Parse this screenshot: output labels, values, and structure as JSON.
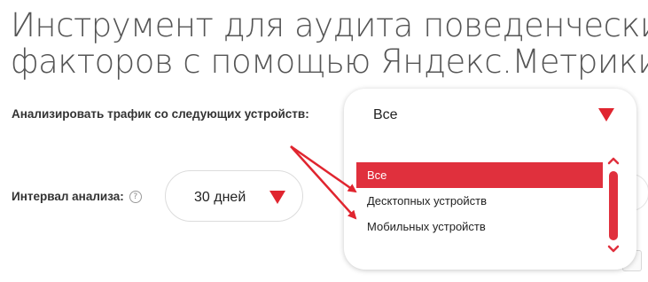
{
  "page": {
    "title_line1": "Инструмент для аудита поведенческих",
    "title_line2": "факторов с помощью Яндекс.Метрики"
  },
  "devices": {
    "label": "Анализировать трафик со следующих устройств:",
    "selected_value": "Все",
    "options": [
      "Все",
      "Десктопных устройств",
      "Мобильных устройств"
    ],
    "active_index": 0
  },
  "interval": {
    "label": "Интервал анализа:",
    "help_glyph": "?",
    "value": "30 дней"
  },
  "colors": {
    "accent": "#e0303d",
    "annotation": "#e0252f"
  },
  "icons": {
    "dropdown": "triangle-down-icon",
    "scroll_up": "chevron-up-icon",
    "scroll_down": "chevron-down-icon",
    "help": "question-circle-icon"
  }
}
